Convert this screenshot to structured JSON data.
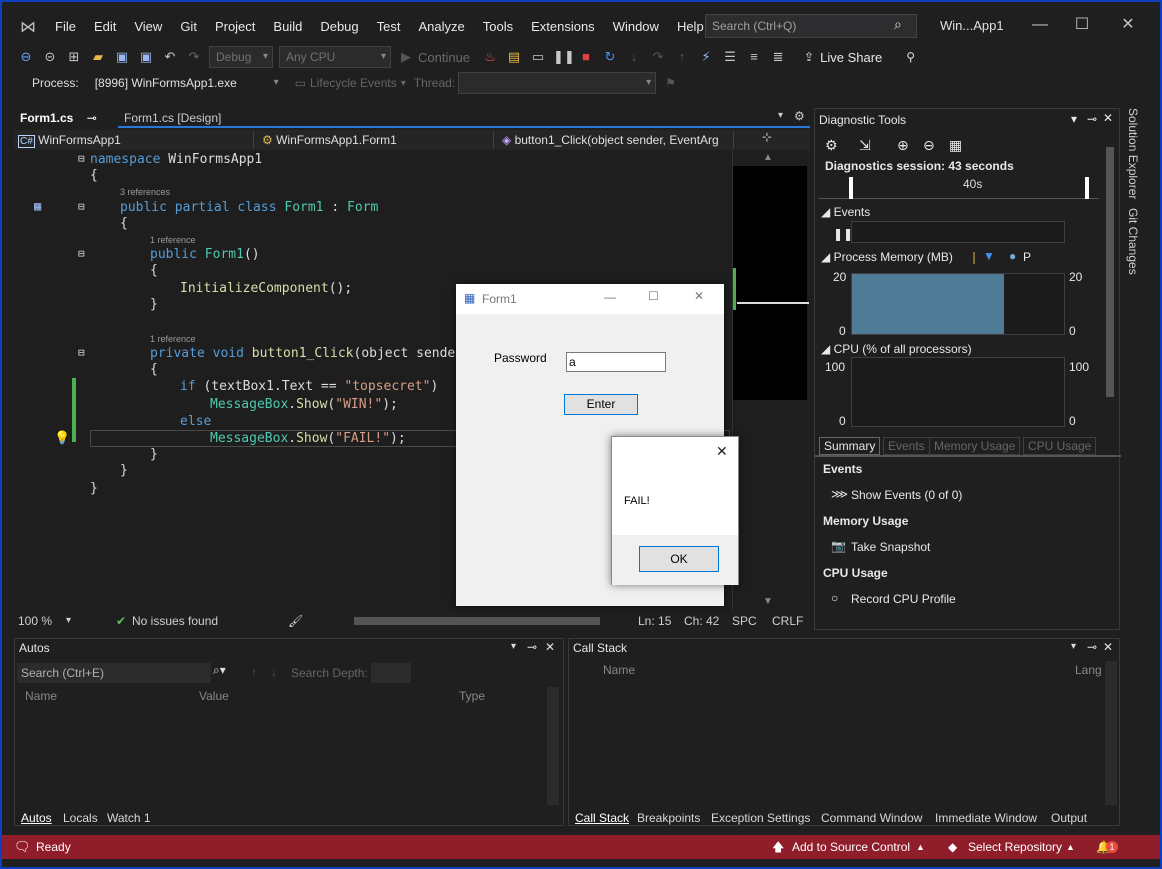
{
  "menu": [
    "File",
    "Edit",
    "View",
    "Git",
    "Project",
    "Build",
    "Debug",
    "Test",
    "Analyze",
    "Tools",
    "Extensions",
    "Window",
    "Help"
  ],
  "search_placeholder": "Search (Ctrl+Q)",
  "app_title": "Win...App1",
  "toolbar": {
    "config": "Debug",
    "platform": "Any CPU",
    "continue": "Continue",
    "live_share": "Live Share"
  },
  "toolbar2": {
    "process_label": "Process:",
    "process": "[8996] WinFormsApp1.exe",
    "lifecycle": "Lifecycle Events",
    "thread": "Thread:"
  },
  "doc_tabs": [
    {
      "label": "Form1.cs",
      "active": true
    },
    {
      "label": "Form1.cs [Design]",
      "active": false
    }
  ],
  "nav": {
    "project": "WinFormsApp1",
    "class": "WinFormsApp1.Form1",
    "member": "button1_Click(object sender, EventArg"
  },
  "code": {
    "l1": "namespace WinFormsApp1",
    "ref1": "3 references",
    "l3a": "public partial class ",
    "l3b": "Form1",
    " l3c": " : ",
    "l3d": "Form",
    "ref2": "1 reference",
    "l5": "Form1",
    "l7": "InitializeComponent",
    "ref3": "1 reference",
    "l9a": "private void ",
    "l9b": "button1_Click",
    "l9c": "(object sender",
    "l11a": "if (textBox1.Text == ",
    "l11b": "\"topsecret\"",
    "l12a": "MessageBox",
    "l12b": "Show",
    "l12c": "\"WIN!\"",
    "l13": "else",
    "l14c": "\"FAIL!\""
  },
  "editor_status": {
    "zoom": "100 %",
    "issues": "No issues found",
    "ln": "Ln: 15",
    "ch": "Ch: 42",
    "spc": "SPC",
    "crlf": "CRLF"
  },
  "diag": {
    "title": "Diagnostic Tools",
    "session": "Diagnostics session: 43 seconds",
    "timeline": "40s",
    "events": "Events",
    "memory": "Process Memory (MB)",
    "mem_legend": "P",
    "mem_max": "20",
    "mem_min": "0",
    "cpu": "CPU (% of all processors)",
    "cpu_max": "100",
    "cpu_min": "0",
    "tabs": [
      "Summary",
      "Events",
      "Memory Usage",
      "CPU Usage"
    ],
    "sec_events": "Events",
    "show_events": "Show Events (0 of 0)",
    "sec_memory": "Memory Usage",
    "take_snapshot": "Take Snapshot",
    "sec_cpu": "CPU Usage",
    "record_cpu": "Record CPU Profile"
  },
  "side_tabs": [
    "Solution Explorer",
    "Git Changes"
  ],
  "autos": {
    "title": "Autos",
    "search": "Search (Ctrl+E)",
    "depth": "Search Depth:",
    "cols": [
      "Name",
      "Value",
      "Type"
    ],
    "tabs": [
      "Autos",
      "Locals",
      "Watch 1"
    ]
  },
  "callstack": {
    "title": "Call Stack",
    "cols": [
      "Name",
      "Lang"
    ],
    "tabs": [
      "Call Stack",
      "Breakpoints",
      "Exception Settings",
      "Command Window",
      "Immediate Window",
      "Output"
    ]
  },
  "status": {
    "ready": "Ready",
    "source": "Add to Source Control",
    "repo": "Select Repository",
    "notif": "1"
  },
  "form1": {
    "title": "Form1",
    "label": "Password",
    "value": "a",
    "button": "Enter"
  },
  "msgbox": {
    "text": "FAIL!",
    "ok": "OK"
  },
  "memory_fill": 1.0
}
